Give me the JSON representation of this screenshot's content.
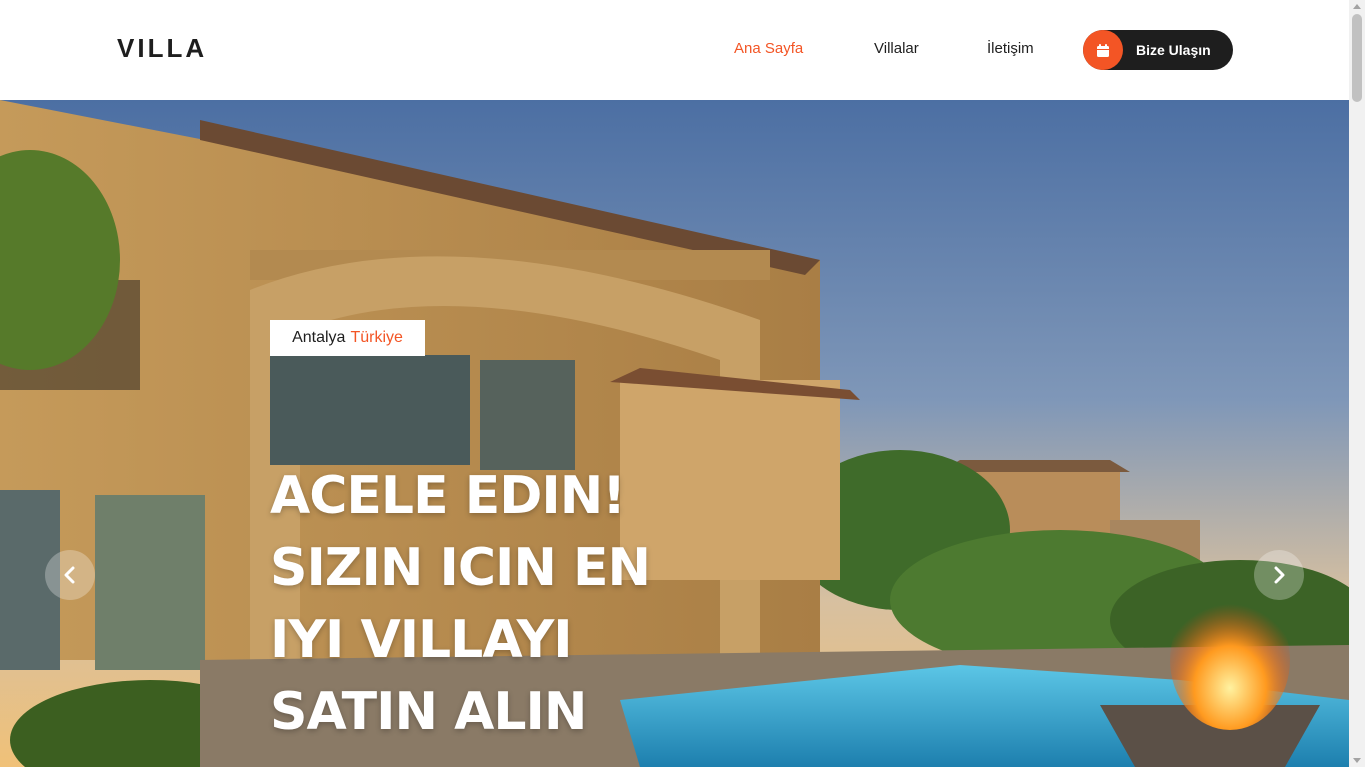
{
  "header": {
    "logo": "VILLA",
    "nav": [
      {
        "label": "Ana Sayfa",
        "active": true
      },
      {
        "label": "Villalar",
        "active": false
      },
      {
        "label": "İletişim",
        "active": false
      }
    ],
    "cta": {
      "label": "Bize Ulaşın",
      "icon": "calendar-icon"
    }
  },
  "hero": {
    "location": {
      "city": "Antalya",
      "country": "Türkiye"
    },
    "title_lines": [
      "ACELE EDIN!",
      "SIZIN ICIN EN",
      "IYI VILLAYI",
      "SATIN ALIN"
    ],
    "prev_icon": "chevron-left-icon",
    "next_icon": "chevron-right-icon"
  },
  "colors": {
    "accent": "#f35525",
    "dark": "#1e1e1e"
  }
}
